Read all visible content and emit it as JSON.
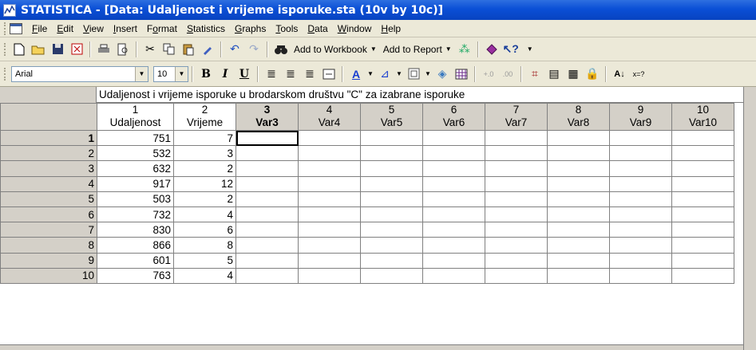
{
  "window": {
    "title": "STATISTICA - [Data: Udaljenost i vrijeme isporuke.sta (10v by 10c)]"
  },
  "menu": [
    {
      "label": "File",
      "accel": "F"
    },
    {
      "label": "Edit",
      "accel": "E"
    },
    {
      "label": "View",
      "accel": "V"
    },
    {
      "label": "Insert",
      "accel": "I"
    },
    {
      "label": "Format",
      "accel": "o"
    },
    {
      "label": "Statistics",
      "accel": "S"
    },
    {
      "label": "Graphs",
      "accel": "G"
    },
    {
      "label": "Tools",
      "accel": "T"
    },
    {
      "label": "Data",
      "accel": "D"
    },
    {
      "label": "Window",
      "accel": "W"
    },
    {
      "label": "Help",
      "accel": "H"
    }
  ],
  "toolbar1": {
    "add_workbook": "Add to Workbook",
    "add_report": "Add to Report"
  },
  "toolbar2": {
    "font_name": "Arial",
    "font_size": "10"
  },
  "sheet": {
    "title": "Udaljenost i vrijeme isporuke u brodarskom društvu \"C\" za izabrane isporuke",
    "columns": [
      {
        "num": "1",
        "name": "Udaljenost"
      },
      {
        "num": "2",
        "name": "Vrijeme"
      },
      {
        "num": "3",
        "name": "Var3"
      },
      {
        "num": "4",
        "name": "Var4"
      },
      {
        "num": "5",
        "name": "Var5"
      },
      {
        "num": "6",
        "name": "Var6"
      },
      {
        "num": "7",
        "name": "Var7"
      },
      {
        "num": "8",
        "name": "Var8"
      },
      {
        "num": "9",
        "name": "Var9"
      },
      {
        "num": "10",
        "name": "Var10"
      }
    ],
    "rows": [
      {
        "num": "1",
        "udaljenost": "751",
        "vrijeme": "7"
      },
      {
        "num": "2",
        "udaljenost": "532",
        "vrijeme": "3"
      },
      {
        "num": "3",
        "udaljenost": "632",
        "vrijeme": "2"
      },
      {
        "num": "4",
        "udaljenost": "917",
        "vrijeme": "12"
      },
      {
        "num": "5",
        "udaljenost": "503",
        "vrijeme": "2"
      },
      {
        "num": "6",
        "udaljenost": "732",
        "vrijeme": "4"
      },
      {
        "num": "7",
        "udaljenost": "830",
        "vrijeme": "6"
      },
      {
        "num": "8",
        "udaljenost": "866",
        "vrijeme": "8"
      },
      {
        "num": "9",
        "udaljenost": "601",
        "vrijeme": "5"
      },
      {
        "num": "10",
        "udaljenost": "763",
        "vrijeme": "4"
      }
    ]
  }
}
